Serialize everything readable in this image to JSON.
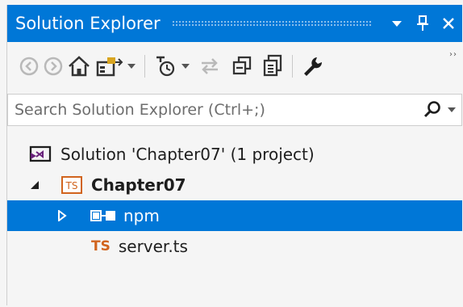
{
  "window": {
    "title": "Solution Explorer"
  },
  "toolbar": {
    "overflow_label": "››"
  },
  "search": {
    "placeholder": "Search Solution Explorer (Ctrl+;)"
  },
  "tree": {
    "solution_label": "Solution 'Chapter07' (1 project)",
    "project_label": "Chapter07",
    "project_icon_text": "TS",
    "npm_label": "npm",
    "file_icon_text": "TS",
    "file_label": "server.ts"
  },
  "colors": {
    "accent": "#0077d7",
    "typescript_orange": "#d1641e"
  }
}
